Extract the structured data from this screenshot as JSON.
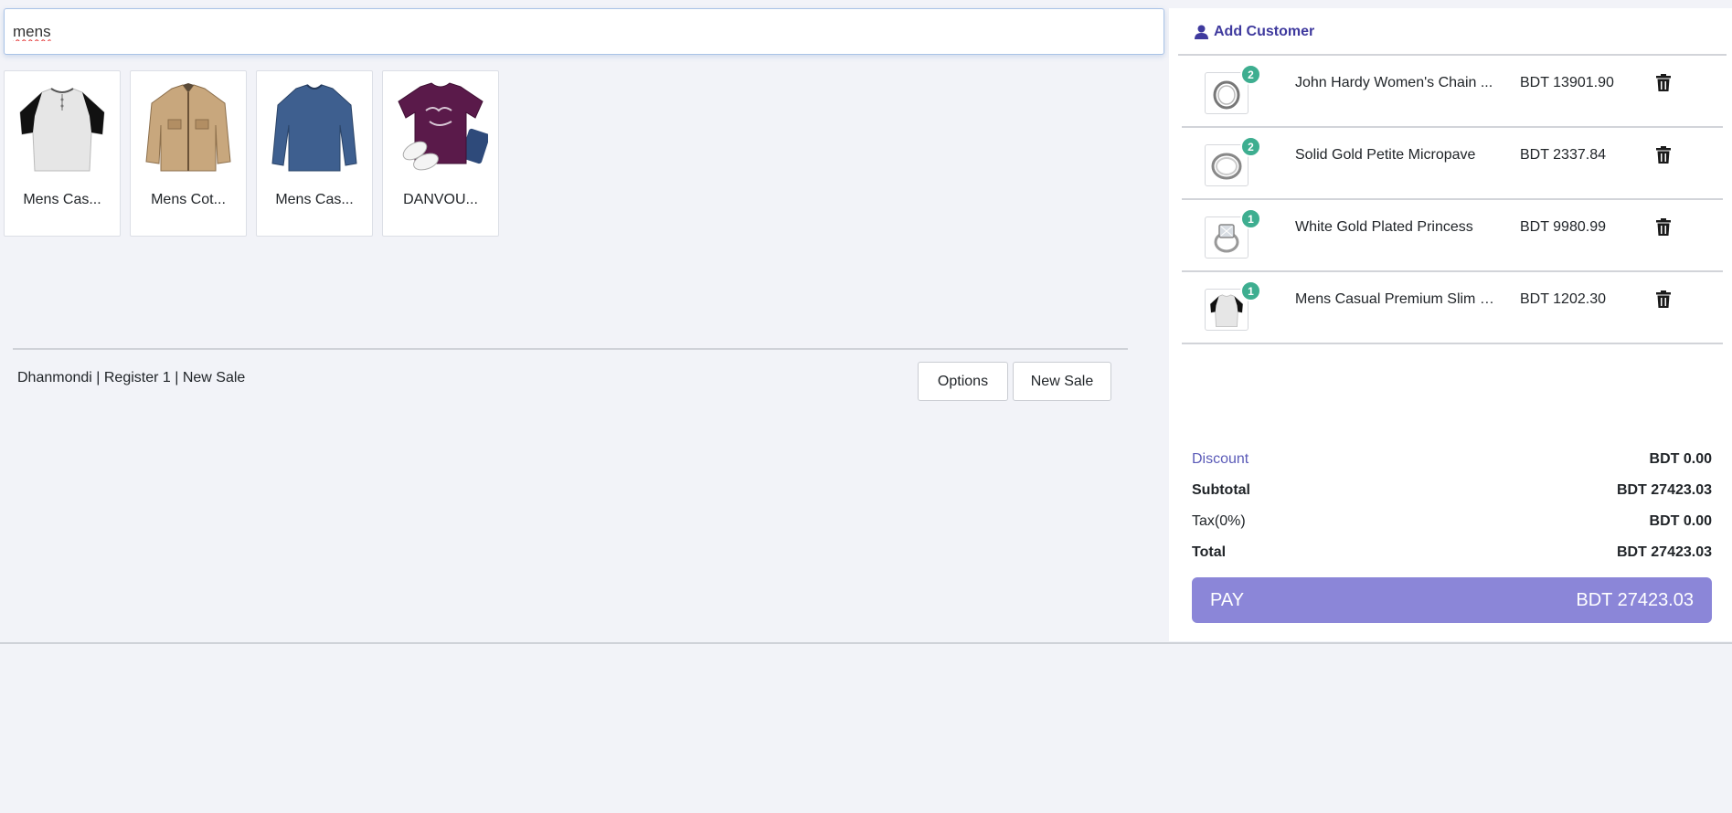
{
  "search": {
    "value": "mens"
  },
  "products": [
    {
      "name": "Mens Cas...",
      "image": "henley-shirt"
    },
    {
      "name": "Mens Cot...",
      "image": "cotton-jacket"
    },
    {
      "name": "Mens Cas...",
      "image": "long-sleeve-tee"
    },
    {
      "name": "DANVOU...",
      "image": "womens-tshirt"
    }
  ],
  "status": {
    "text": "Dhanmondi | Register 1 | New Sale"
  },
  "buttons": {
    "options": "Options",
    "new_sale": "New Sale"
  },
  "customer": {
    "add_label": "Add Customer",
    "icon": "user-icon"
  },
  "cart": {
    "items": [
      {
        "name": "John Hardy Women's Chain ...",
        "price": "BDT 13901.90",
        "qty": "2",
        "image": "chain-bracelet"
      },
      {
        "name": "Solid Gold Petite Micropave",
        "price": "BDT 2337.84",
        "qty": "2",
        "image": "ring"
      },
      {
        "name": "White Gold Plated Princess",
        "price": "BDT 9980.99",
        "qty": "1",
        "image": "diamond-ring"
      },
      {
        "name": "Mens Casual Premium Slim F...",
        "price": "BDT 1202.30",
        "qty": "1",
        "image": "henley-shirt"
      }
    ]
  },
  "summary": {
    "discount_label": "Discount",
    "discount_value": "BDT 0.00",
    "subtotal_label": "Subtotal",
    "subtotal_value": "BDT 27423.03",
    "tax_label": "Tax(0%)",
    "tax_value": "BDT 0.00",
    "total_label": "Total",
    "total_value": "BDT 27423.03"
  },
  "pay": {
    "label": "PAY",
    "amount": "BDT 27423.03"
  },
  "colors": {
    "accent": "#8b86d8",
    "badge": "#3eae90",
    "link": "#3f3a9e"
  }
}
